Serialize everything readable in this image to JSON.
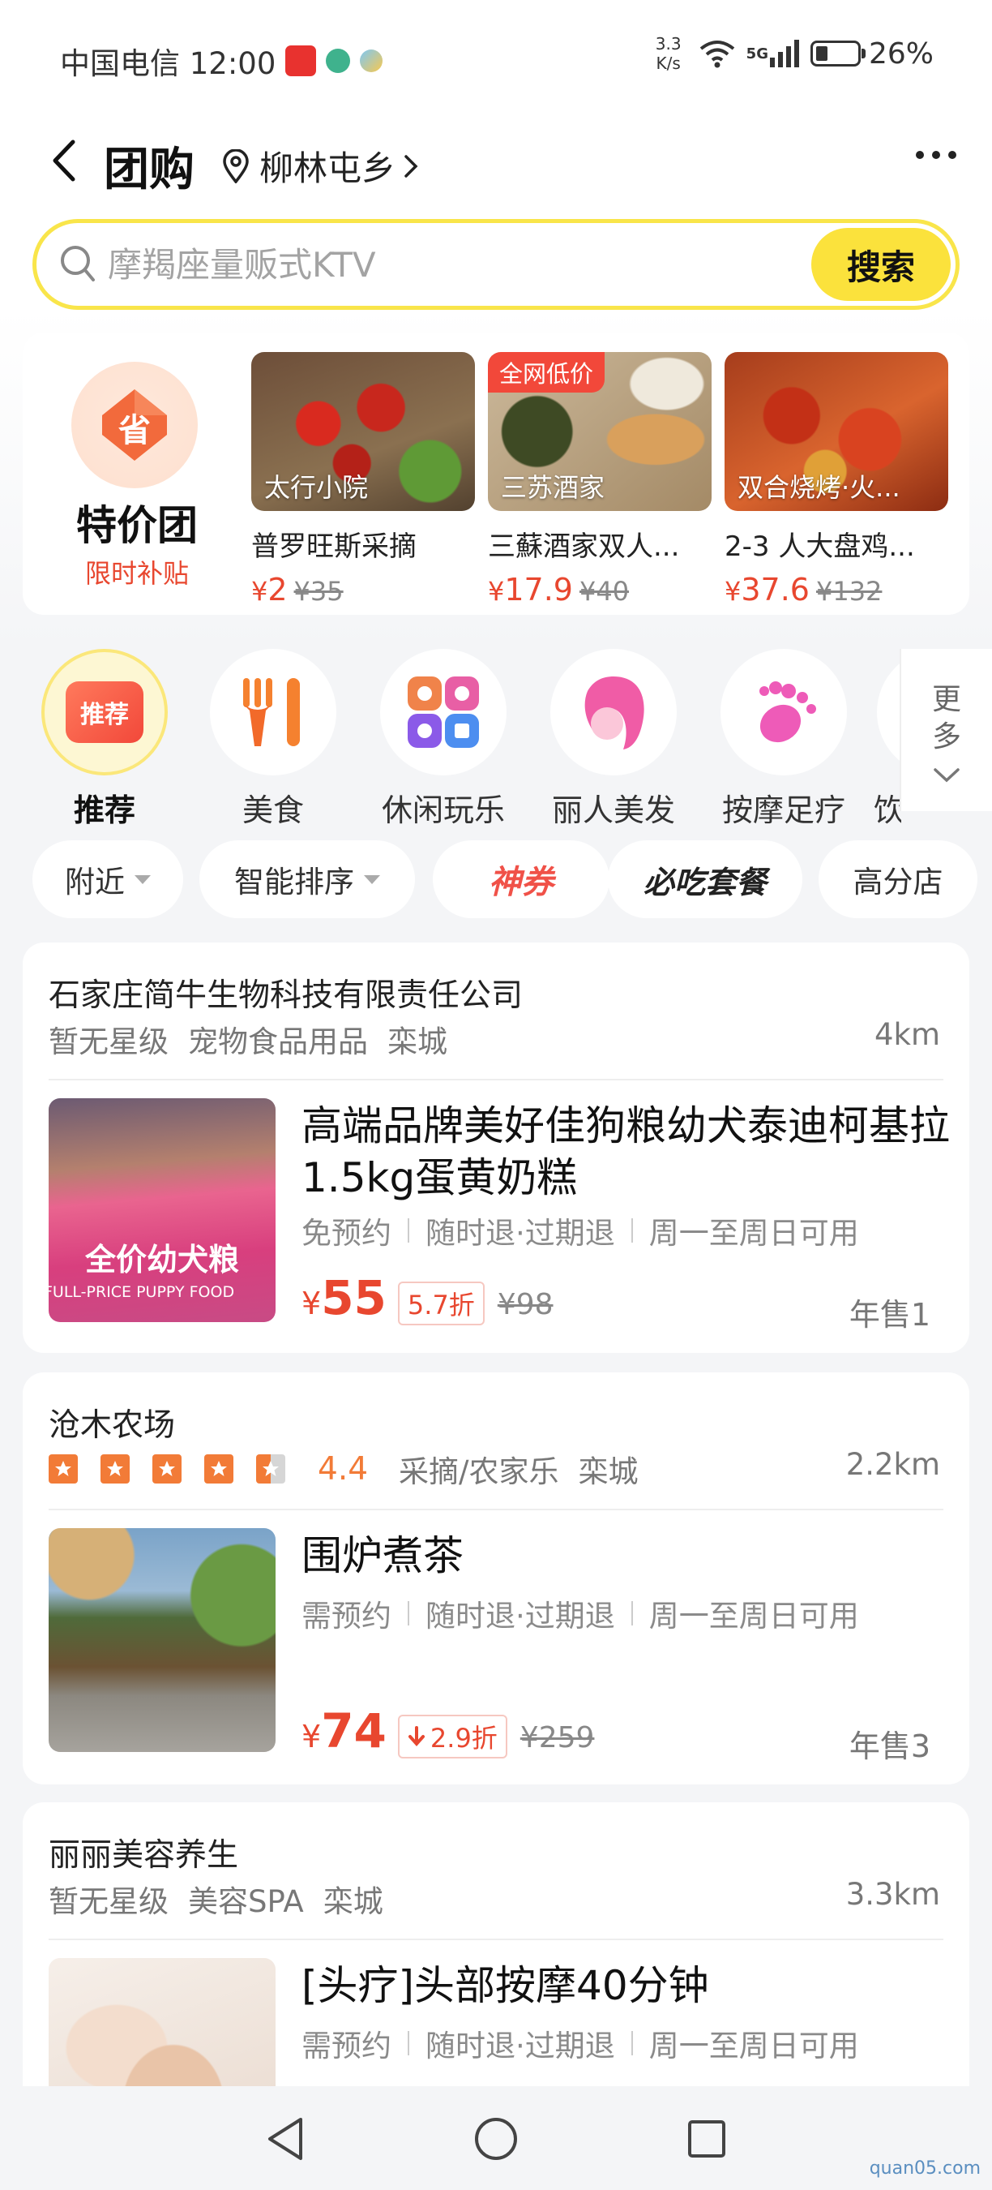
{
  "status_bar": {
    "carrier_time": "中国电信 12:00",
    "speed_value": "3.3",
    "speed_unit": "K/s",
    "network": "5G",
    "battery_pct": "26%",
    "battery_level": 0.26
  },
  "header": {
    "title": "团购",
    "location": "柳林屯乡"
  },
  "search": {
    "placeholder": "摩羯座量贩式KTV",
    "button": "搜索",
    "accent_color": "#fbe23c"
  },
  "deals": {
    "brand_title": "特价团",
    "brand_sub": "限时补贴",
    "brand_badge_char": "省",
    "items": [
      {
        "img_label": "太行小院",
        "tag": "",
        "name": "普罗旺斯采摘",
        "price": "2",
        "old": "¥35"
      },
      {
        "img_label": "三苏酒家",
        "tag": "全网低价",
        "name": "三蘇酒家双人...",
        "price": "17.9",
        "old": "¥40"
      },
      {
        "img_label": "双合烧烤·火...",
        "tag": "",
        "name": "2-3 人大盘鸡...",
        "price": "37.6",
        "old": "¥132"
      }
    ]
  },
  "categories": {
    "items": [
      {
        "label": "推荐",
        "badge": "推荐",
        "icon": "recommend-icon"
      },
      {
        "label": "美食",
        "icon": "fork-knife-icon"
      },
      {
        "label": "休闲玩乐",
        "icon": "leisure-icon"
      },
      {
        "label": "丽人美发",
        "icon": "beauty-icon"
      },
      {
        "label": "按摩足疗",
        "icon": "foot-icon"
      }
    ],
    "partial_label": "饮",
    "more_label_1": "更",
    "more_label_2": "多"
  },
  "filters": {
    "nearby": "附近",
    "sort": "智能排序",
    "coupon": "神券",
    "must_eat": "必吃套餐",
    "high_score": "高分店"
  },
  "listings": [
    {
      "shop_name": "石家庄简牛生物科技有限责任公司",
      "rating_text": "暂无星级",
      "category": "宠物食品用品",
      "area": "栾城",
      "distance": "4km",
      "product_title": "高端品牌美好佳狗粮幼犬泰迪柯基拉1.5kg蛋黄奶糕",
      "image_caption": "全价幼犬粮",
      "image_caption_en": "FULL-PRICE PUPPY FOOD",
      "tag1": "免预约",
      "tag2": "随时退·过期退",
      "tag3": "周一至周日可用",
      "price": "55",
      "discount": "5.7折",
      "old_price": "¥98",
      "sales": "年售1"
    },
    {
      "shop_name": "沧木农场",
      "rating_value": "4.4",
      "rating_stars": 4.5,
      "category": "采摘/农家乐",
      "area": "栾城",
      "distance": "2.2km",
      "product_title": "围炉煮茶",
      "tag1": "需预约",
      "tag2": "随时退·过期退",
      "tag3": "周一至周日可用",
      "price": "74",
      "discount": "2.9折",
      "old_price": "¥259",
      "sales": "年售3"
    },
    {
      "shop_name": "丽丽美容养生",
      "rating_text": "暂无星级",
      "category": "美容SPA",
      "area": "栾城",
      "distance": "3.3km",
      "product_title": "[头疗]头部按摩40分钟",
      "tag1": "需预约",
      "tag2": "随时退·过期退",
      "tag3": "周一至周日可用"
    }
  ],
  "currency": "¥",
  "watermark": "quan05.com",
  "colors": {
    "price_red": "#e8472f",
    "rating_orange": "#f27b37",
    "brand_yellow": "#fbe23c"
  }
}
